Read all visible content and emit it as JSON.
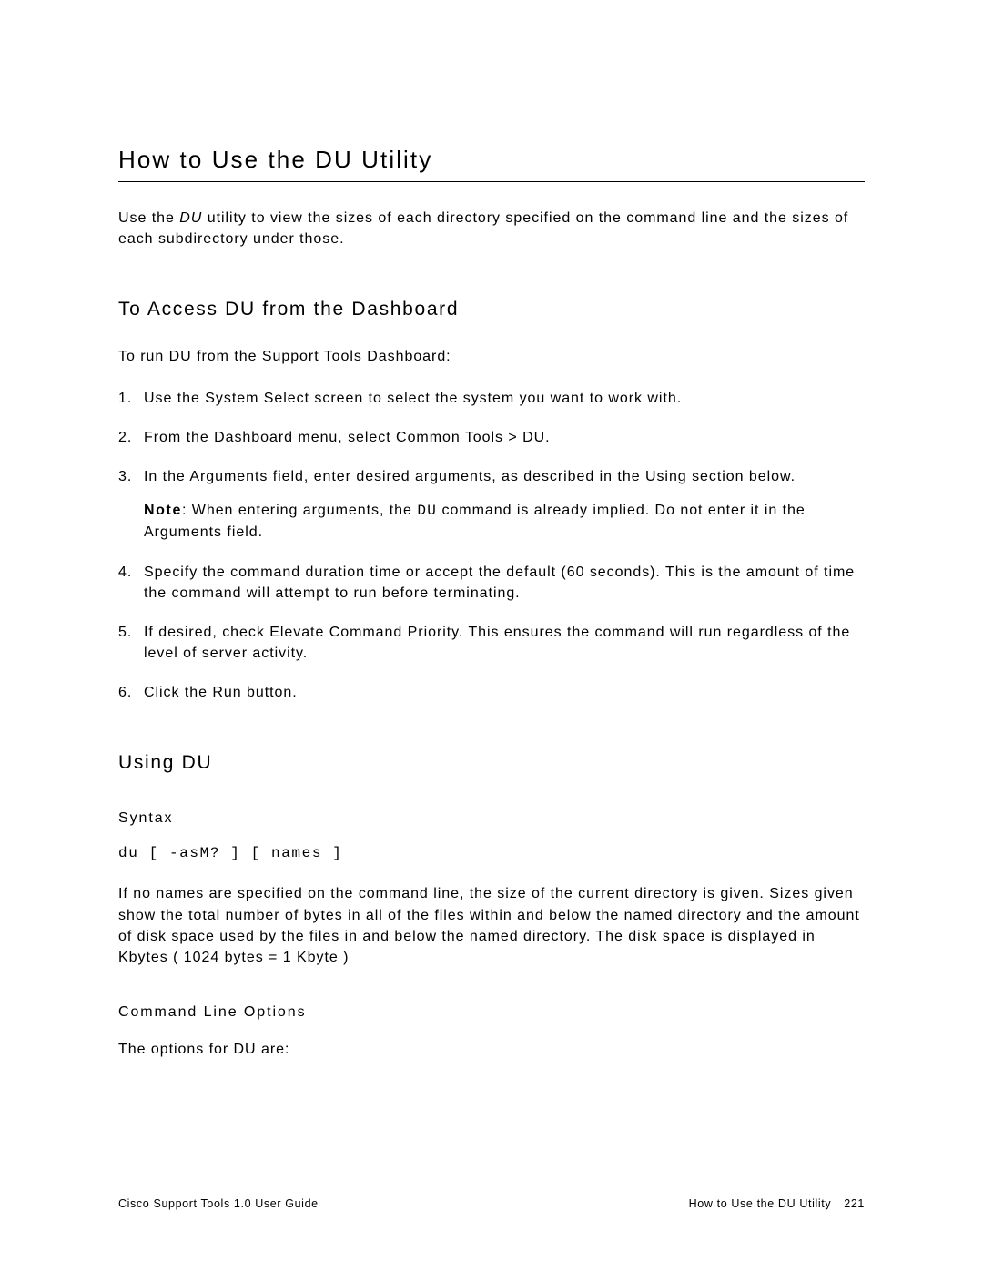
{
  "title": "How to Use the DU Utility",
  "intro_pre": "Use the ",
  "intro_em": "DU",
  "intro_post": " utility to view the sizes of each directory specified on the command line and the sizes of each subdirectory under those.",
  "section_access": {
    "heading": "To Access DU from the Dashboard",
    "lead": "To run DU from the Support Tools Dashboard:",
    "steps": [
      {
        "n": "1.",
        "text": "Use the System Select screen to select the system you want to work with."
      },
      {
        "n": "2.",
        "text": "From the Dashboard menu, select Common Tools > DU."
      },
      {
        "n": "3.",
        "text": "In the Arguments field, enter desired arguments, as described in the Using section below.",
        "note_label": "Note",
        "note_pre": ": When entering arguments, the ",
        "note_mono": "DU",
        "note_post": " command is already implied. Do not enter it in the Arguments field."
      },
      {
        "n": "4.",
        "text": "Specify the command duration time or accept the default (60 seconds). This is the amount of time the command will attempt to run before terminating."
      },
      {
        "n": "5.",
        "text": "If desired, check Elevate Command Priority. This ensures the command will run regardless of the level of server activity."
      },
      {
        "n": "6.",
        "text": "Click the Run button."
      }
    ]
  },
  "section_using": {
    "heading": "Using DU",
    "syntax_heading": "Syntax",
    "syntax": "du [ -asM? ] [ names ]",
    "desc": "If no names are specified on the command line, the size of the current directory is given. Sizes given show the total number of bytes in all of the files within and below the named directory and the amount of disk space used by the files in and below the named directory. The disk space is displayed in Kbytes ( 1024 bytes = 1 Kbyte )",
    "clo_heading": "Command Line Options",
    "clo_lead": "The options for DU are:"
  },
  "footer": {
    "left": "Cisco Support Tools 1.0 User Guide",
    "right_label": "How to Use the DU Utility",
    "page": "221"
  }
}
